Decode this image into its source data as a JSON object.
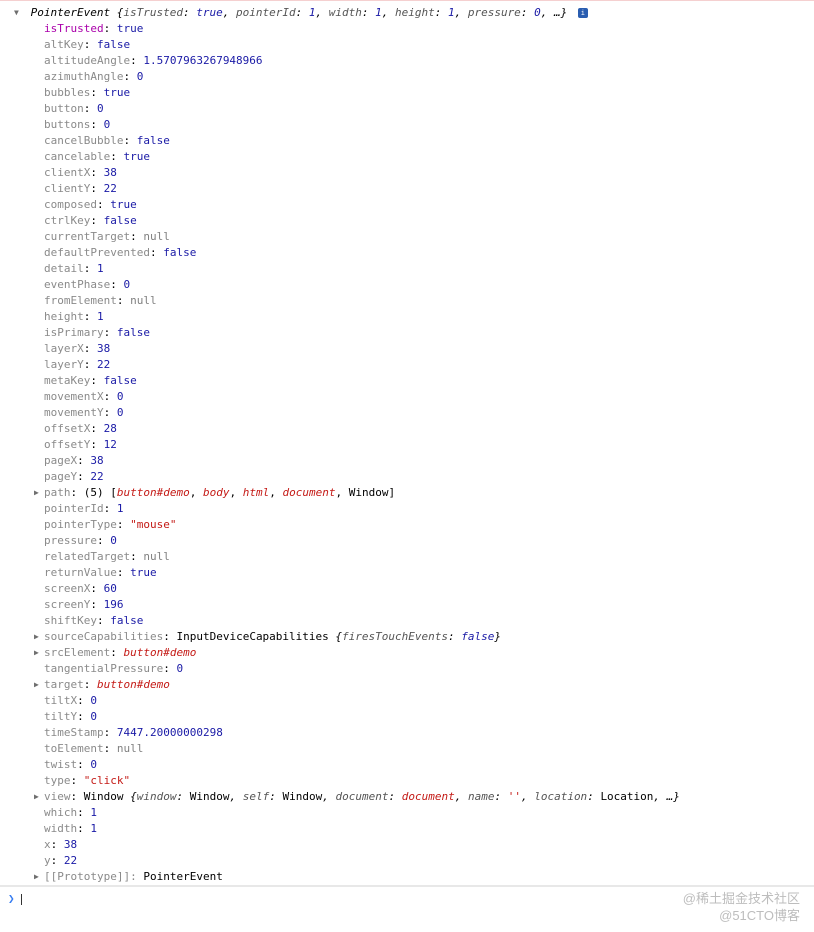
{
  "header": {
    "className": "PointerEvent",
    "summary": [
      {
        "k": "isTrusted",
        "v": "true",
        "t": "bool"
      },
      {
        "k": "pointerId",
        "v": "1",
        "t": "num"
      },
      {
        "k": "width",
        "v": "1",
        "t": "num"
      },
      {
        "k": "height",
        "v": "1",
        "t": "num"
      },
      {
        "k": "pressure",
        "v": "0",
        "t": "num"
      }
    ],
    "ellipsis": "…",
    "info": "i"
  },
  "props": [
    {
      "k": "isTrusted",
      "own": true,
      "t": "bool",
      "v": "true"
    },
    {
      "k": "altKey",
      "own": false,
      "t": "bool",
      "v": "false"
    },
    {
      "k": "altitudeAngle",
      "own": false,
      "t": "num",
      "v": "1.5707963267948966"
    },
    {
      "k": "azimuthAngle",
      "own": false,
      "t": "num",
      "v": "0"
    },
    {
      "k": "bubbles",
      "own": false,
      "t": "bool",
      "v": "true"
    },
    {
      "k": "button",
      "own": false,
      "t": "num",
      "v": "0"
    },
    {
      "k": "buttons",
      "own": false,
      "t": "num",
      "v": "0"
    },
    {
      "k": "cancelBubble",
      "own": false,
      "t": "bool",
      "v": "false"
    },
    {
      "k": "cancelable",
      "own": false,
      "t": "bool",
      "v": "true"
    },
    {
      "k": "clientX",
      "own": false,
      "t": "num",
      "v": "38"
    },
    {
      "k": "clientY",
      "own": false,
      "t": "num",
      "v": "22"
    },
    {
      "k": "composed",
      "own": false,
      "t": "bool",
      "v": "true"
    },
    {
      "k": "ctrlKey",
      "own": false,
      "t": "bool",
      "v": "false"
    },
    {
      "k": "currentTarget",
      "own": false,
      "t": "null",
      "v": "null"
    },
    {
      "k": "defaultPrevented",
      "own": false,
      "t": "bool",
      "v": "false"
    },
    {
      "k": "detail",
      "own": false,
      "t": "num",
      "v": "1"
    },
    {
      "k": "eventPhase",
      "own": false,
      "t": "num",
      "v": "0"
    },
    {
      "k": "fromElement",
      "own": false,
      "t": "null",
      "v": "null"
    },
    {
      "k": "height",
      "own": false,
      "t": "num",
      "v": "1"
    },
    {
      "k": "isPrimary",
      "own": false,
      "t": "bool",
      "v": "false"
    },
    {
      "k": "layerX",
      "own": false,
      "t": "num",
      "v": "38"
    },
    {
      "k": "layerY",
      "own": false,
      "t": "num",
      "v": "22"
    },
    {
      "k": "metaKey",
      "own": false,
      "t": "bool",
      "v": "false"
    },
    {
      "k": "movementX",
      "own": false,
      "t": "num",
      "v": "0"
    },
    {
      "k": "movementY",
      "own": false,
      "t": "num",
      "v": "0"
    },
    {
      "k": "offsetX",
      "own": false,
      "t": "num",
      "v": "28"
    },
    {
      "k": "offsetY",
      "own": false,
      "t": "num",
      "v": "12"
    },
    {
      "k": "pageX",
      "own": false,
      "t": "num",
      "v": "38"
    },
    {
      "k": "pageY",
      "own": false,
      "t": "num",
      "v": "22"
    },
    {
      "k": "path",
      "own": false,
      "t": "path",
      "arrow": true,
      "len": "(5)",
      "items": [
        {
          "t": "enum",
          "v": "button#demo"
        },
        {
          "t": "enum",
          "v": "body"
        },
        {
          "t": "enum",
          "v": "html"
        },
        {
          "t": "enum",
          "v": "document"
        },
        {
          "t": "obj",
          "v": "Window"
        }
      ]
    },
    {
      "k": "pointerId",
      "own": false,
      "t": "num",
      "v": "1"
    },
    {
      "k": "pointerType",
      "own": false,
      "t": "str",
      "v": "\"mouse\""
    },
    {
      "k": "pressure",
      "own": false,
      "t": "num",
      "v": "0"
    },
    {
      "k": "relatedTarget",
      "own": false,
      "t": "null",
      "v": "null"
    },
    {
      "k": "returnValue",
      "own": false,
      "t": "bool",
      "v": "true"
    },
    {
      "k": "screenX",
      "own": false,
      "t": "num",
      "v": "60"
    },
    {
      "k": "screenY",
      "own": false,
      "t": "num",
      "v": "196"
    },
    {
      "k": "shiftKey",
      "own": false,
      "t": "bool",
      "v": "false"
    },
    {
      "k": "sourceCapabilities",
      "own": false,
      "t": "srcCap",
      "arrow": true,
      "cls": "InputDeviceCapabilities",
      "inner_k": "firesTouchEvents",
      "inner_v": "false"
    },
    {
      "k": "srcElement",
      "own": false,
      "t": "enum",
      "arrow": true,
      "v": "button#demo"
    },
    {
      "k": "tangentialPressure",
      "own": false,
      "t": "num",
      "v": "0"
    },
    {
      "k": "target",
      "own": false,
      "t": "enum",
      "arrow": true,
      "v": "button#demo"
    },
    {
      "k": "tiltX",
      "own": false,
      "t": "num",
      "v": "0"
    },
    {
      "k": "tiltY",
      "own": false,
      "t": "num",
      "v": "0"
    },
    {
      "k": "timeStamp",
      "own": false,
      "t": "num",
      "v": "7447.20000000298"
    },
    {
      "k": "toElement",
      "own": false,
      "t": "null",
      "v": "null"
    },
    {
      "k": "twist",
      "own": false,
      "t": "num",
      "v": "0"
    },
    {
      "k": "type",
      "own": false,
      "t": "str",
      "v": "\"click\""
    },
    {
      "k": "view",
      "own": false,
      "t": "view",
      "arrow": true,
      "cls": "Window",
      "entries": [
        {
          "k": "window",
          "t": "obj",
          "v": "Window"
        },
        {
          "k": "self",
          "t": "obj",
          "v": "Window"
        },
        {
          "k": "document",
          "t": "enum",
          "v": "document"
        },
        {
          "k": "name",
          "t": "str",
          "v": "''"
        },
        {
          "k": "location",
          "t": "obj",
          "v": "Location"
        }
      ],
      "ellipsis": "…"
    },
    {
      "k": "which",
      "own": false,
      "t": "num",
      "v": "1"
    },
    {
      "k": "width",
      "own": false,
      "t": "num",
      "v": "1"
    },
    {
      "k": "x",
      "own": false,
      "t": "num",
      "v": "38"
    },
    {
      "k": "y",
      "own": false,
      "t": "num",
      "v": "22"
    },
    {
      "k": "[[Prototype]]",
      "own": false,
      "t": "proto",
      "arrow": true,
      "v": "PointerEvent"
    }
  ],
  "watermark": {
    "l1": "@稀土掘金技术社区",
    "l2": "@51CTO博客"
  }
}
